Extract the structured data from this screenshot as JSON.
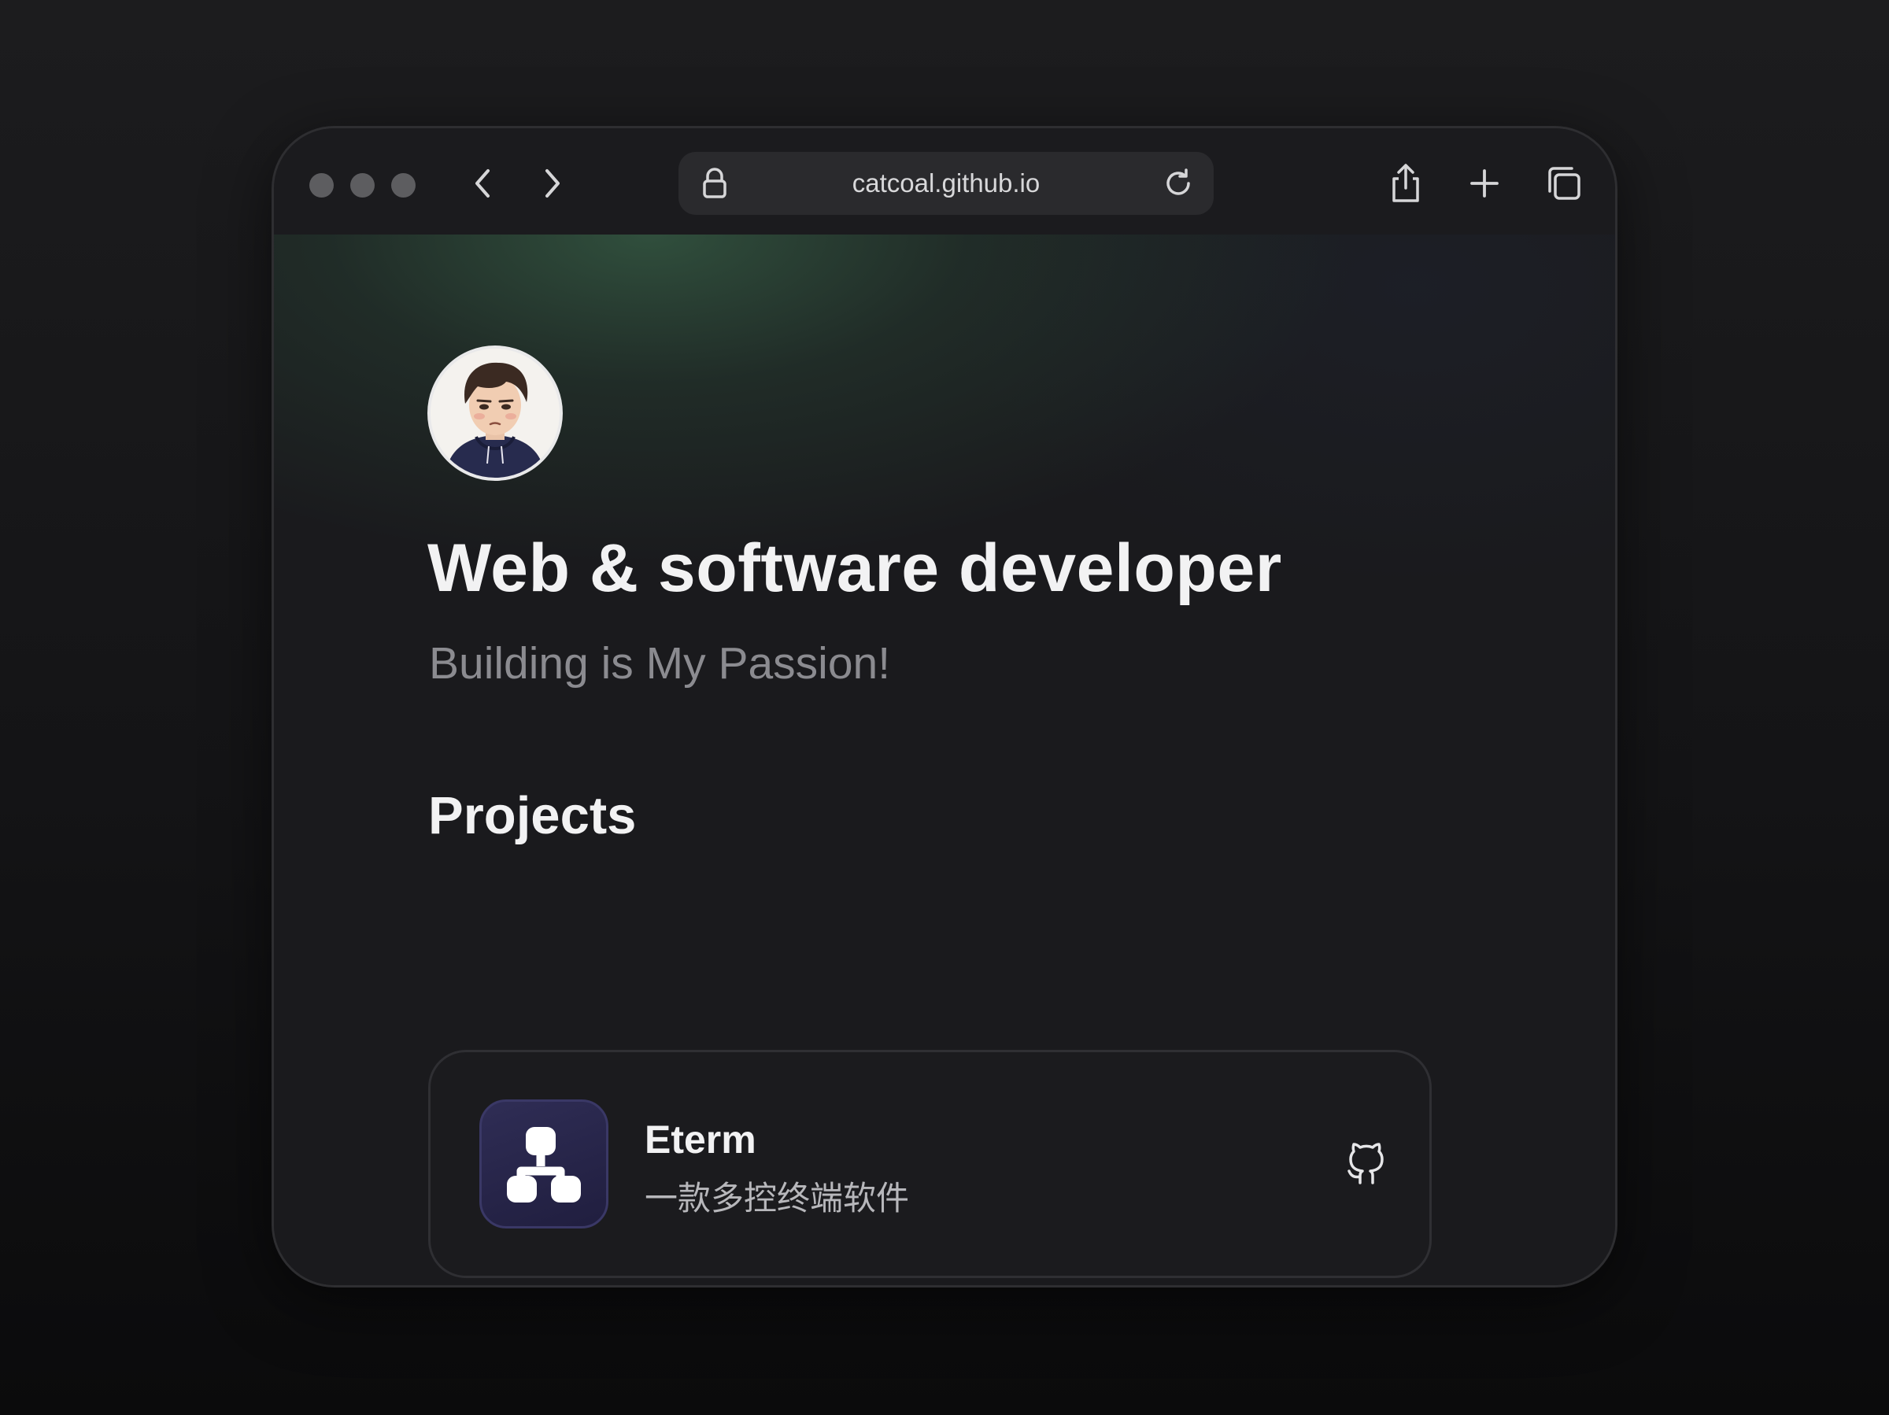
{
  "browser": {
    "url": "catcoal.github.io",
    "icons": {
      "back": "chevron-left-icon",
      "forward": "chevron-right-icon",
      "lock": "lock-icon",
      "reload": "reload-icon",
      "share": "share-icon",
      "new_tab": "plus-icon",
      "tabs": "tabs-overview-icon"
    }
  },
  "hero": {
    "title": "Web & software developer",
    "subtitle": "Building is My Passion!"
  },
  "projects": {
    "heading": "Projects",
    "items": [
      {
        "name": "Eterm",
        "description": "一款多控终端软件",
        "icon": "network-nodes-icon",
        "link_icon": "github-icon"
      }
    ]
  },
  "colors": {
    "background": "#141416",
    "window": "#1a1a1d",
    "accent_green": "#345842",
    "project_icon_bg": "#2a2850",
    "text_primary": "#f2f2f3",
    "text_secondary": "#8b8b90"
  }
}
